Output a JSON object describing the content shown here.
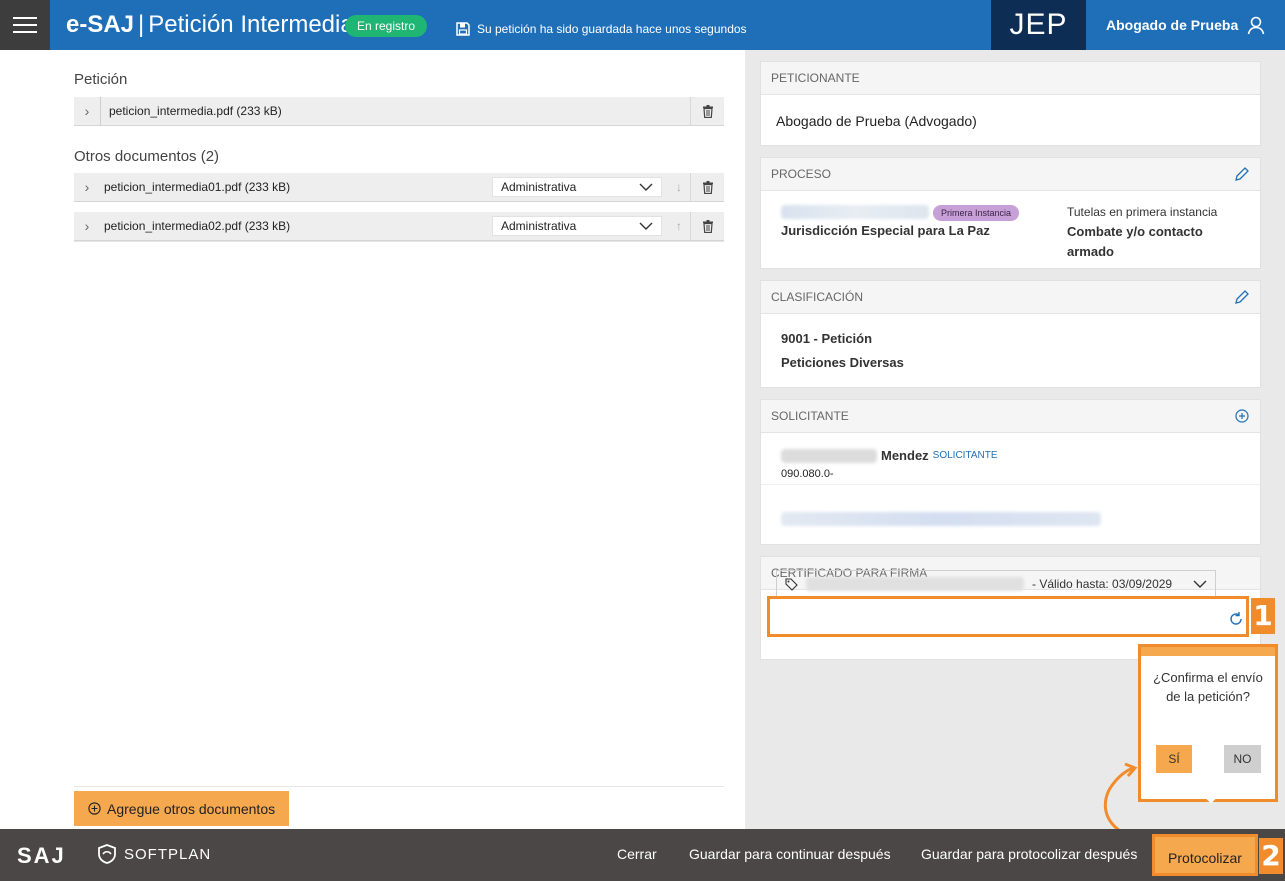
{
  "header": {
    "brand": "e-SAJ",
    "separator": "|",
    "title": "Petición Intermedia",
    "status_badge": "En registro",
    "save_note": "Su petición ha sido guardada hace unos segundos",
    "org": "JEP",
    "user": "Abogado de Prueba"
  },
  "left": {
    "peticion_title": "Petición",
    "main_doc": "peticion_intermedia.pdf (233 kB)",
    "otros_title": "Otros documentos (2)",
    "otros_docs": [
      {
        "name": "peticion_intermedia01.pdf (233 kB)",
        "type": "Administrativa",
        "move": "↓"
      },
      {
        "name": "peticion_intermedia02.pdf (233 kB)",
        "type": "Administrativa",
        "move": "↑"
      }
    ],
    "add_button": "Agregue otros documentos"
  },
  "right": {
    "peticionante": {
      "title": "PETICIONANTE",
      "value": "Abogado de Prueba (Advogado)"
    },
    "proceso": {
      "title": "PROCESO",
      "chip": "Primera Instancia",
      "court": "Jurisdicción Especial para La Paz",
      "subtitle": "Tutelas en primera instancia",
      "detail": "Combate y/o contacto armado"
    },
    "clasificacion": {
      "title": "CLASIFICACIÓN",
      "line1": "9001 - Petición",
      "line2": "Peticiones Diversas"
    },
    "solicitante": {
      "title": "SOLICITANTE",
      "surname": "Mendez",
      "role": "SOLICITANTE",
      "id": "090.080.0-"
    },
    "certificado": {
      "title": "CERTIFICADO PARA FIRMA",
      "valid": "- Válido hasta: 03/09/2029"
    }
  },
  "callouts": {
    "one": "1",
    "two": "2"
  },
  "confirm": {
    "question": "¿Confirma el envío de la petición?",
    "yes": "SÍ",
    "no": "NO"
  },
  "footer": {
    "saj": "SAJ",
    "softplan": "SOFTPLAN",
    "cerrar": "Cerrar",
    "guardar_continuar": "Guardar para continuar después",
    "guardar_protocolizar": "Guardar para protocolizar después",
    "protocolizar": "Protocolizar"
  },
  "colors": {
    "header_blue": "#1f6fb8",
    "jep_navy": "#0e2d55",
    "accent_orange": "#f08c2c",
    "badge_green": "#1fb573"
  }
}
